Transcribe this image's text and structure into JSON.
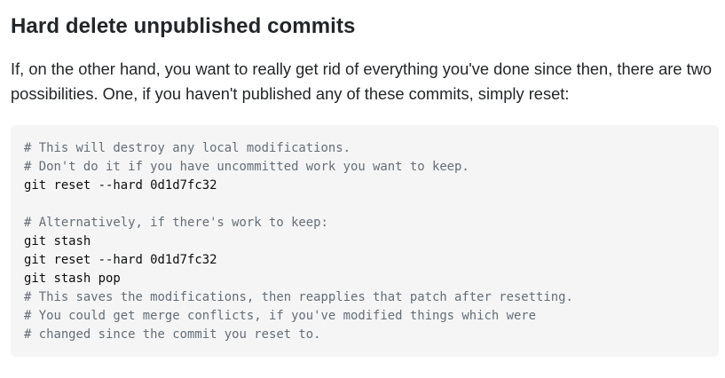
{
  "heading": "Hard delete unpublished commits",
  "paragraph": "If, on the other hand, you want to really get rid of everything you've done since then, there are two possibilities. One, if you haven't published any of these commits, simply reset:",
  "code": {
    "lines": [
      {
        "text": "# This will destroy any local modifications.",
        "comment": true
      },
      {
        "text": "# Don't do it if you have uncommitted work you want to keep.",
        "comment": true
      },
      {
        "text": "git reset --hard 0d1d7fc32",
        "comment": false
      },
      {
        "text": "",
        "comment": false
      },
      {
        "text": "# Alternatively, if there's work to keep:",
        "comment": true
      },
      {
        "text": "git stash",
        "comment": false
      },
      {
        "text": "git reset --hard 0d1d7fc32",
        "comment": false
      },
      {
        "text": "git stash pop",
        "comment": false
      },
      {
        "text": "# This saves the modifications, then reapplies that patch after resetting.",
        "comment": true
      },
      {
        "text": "# You could get merge conflicts, if you've modified things which were",
        "comment": true
      },
      {
        "text": "# changed since the commit you reset to.",
        "comment": true
      }
    ]
  },
  "colors": {
    "text": "#232629",
    "code_background": "#f5f5f5",
    "code_text": "#0c0d0e",
    "code_comment": "#656e77"
  }
}
